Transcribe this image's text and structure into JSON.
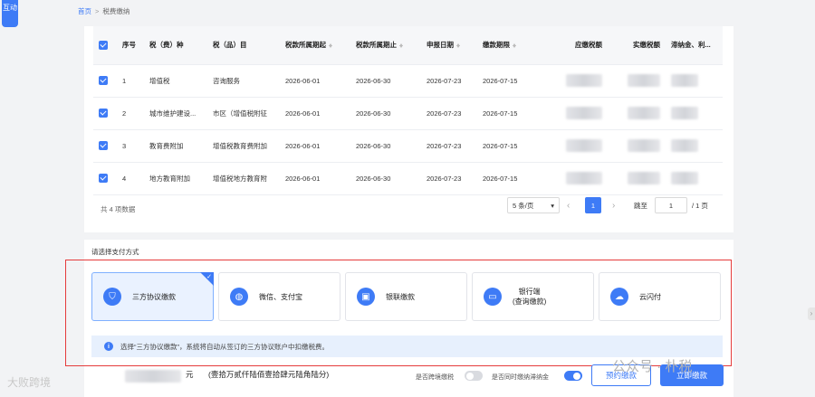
{
  "side_tab": {
    "label": "互动"
  },
  "breadcrumb": {
    "home": "首页",
    "separator": ">",
    "current": "税费缴纳"
  },
  "table": {
    "headers": [
      "序号",
      "税（费）种",
      "税（品）目",
      "税款所属期起",
      "税款所属期止",
      "申报日期",
      "缴款期限",
      "应缴税额",
      "实缴税额",
      "滞纳金、利..."
    ],
    "rows": [
      {
        "index": "1",
        "tax_type": "增值税",
        "tax_item": "咨询服务",
        "period_start": "2026-06-01",
        "period_end": "2026-06-30",
        "declare_date": "2026-07-23",
        "deadline": "2026-07-15"
      },
      {
        "index": "2",
        "tax_type": "城市维护建设...",
        "tax_item": "市区（增值税附征",
        "period_start": "2026-06-01",
        "period_end": "2026-06-30",
        "declare_date": "2026-07-23",
        "deadline": "2026-07-15"
      },
      {
        "index": "3",
        "tax_type": "教育费附加",
        "tax_item": "增值税教育费附加",
        "period_start": "2026-06-01",
        "period_end": "2026-06-30",
        "declare_date": "2026-07-23",
        "deadline": "2026-07-15"
      },
      {
        "index": "4",
        "tax_type": "地方教育附加",
        "tax_item": "增值税地方教育附",
        "period_start": "2026-06-01",
        "period_end": "2026-06-30",
        "declare_date": "2026-07-23",
        "deadline": "2026-07-15"
      }
    ]
  },
  "pagination": {
    "total": "共 4 项数据",
    "page_size": "5 条/页",
    "current_page": "1",
    "jump_label": "跳至",
    "jump_value": "1",
    "total_pages": "/ 1 页"
  },
  "payment": {
    "title": "请选择支付方式",
    "methods": [
      {
        "label": "三方协议缴款",
        "icon": "shield-icon"
      },
      {
        "label": "微信、支付宝",
        "icon": "wallet-icon"
      },
      {
        "label": "银联缴款",
        "icon": "unionpay-icon"
      },
      {
        "label_line1": "银行端",
        "label_line2": "(查询缴款)",
        "icon": "bank-card-icon"
      },
      {
        "label": "云闪付",
        "icon": "cloud-icon"
      }
    ],
    "info": "选择“三方协议缴款”，系统将自动从签订的三方协议账户中扣缴税费。"
  },
  "footer": {
    "amount_unit": "元",
    "amount_upper": "(壹拾万贰仟陆佰壹拾肆元陆角陆分)",
    "cross_region_label": "是否跨境缴税",
    "late_fee_label": "是否同时缴纳滞纳金",
    "schedule_button": "预约缴款",
    "pay_button": "立即缴款"
  },
  "watermarks": {
    "right": "公众号 · 朴税",
    "left": "大败跨境"
  },
  "colors": {
    "primary": "#3e7bf6",
    "highlight_border": "#e53b3b",
    "info_bg": "#e7f0fd"
  }
}
